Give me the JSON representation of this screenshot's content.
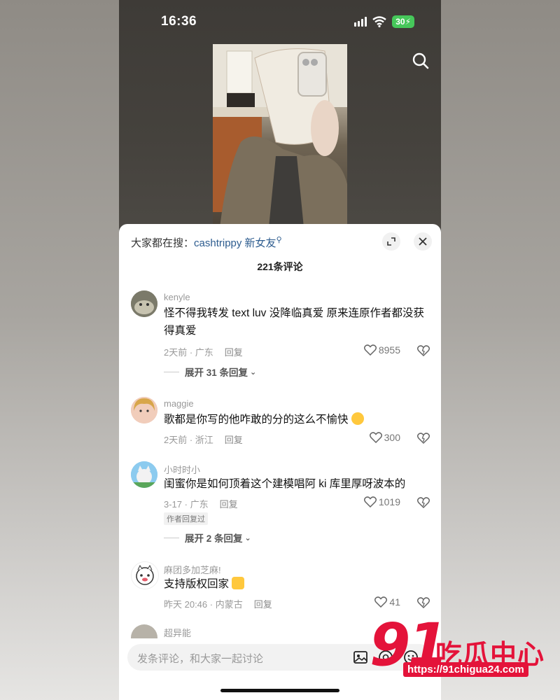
{
  "status": {
    "time": "16:36",
    "battery": "30"
  },
  "video": {
    "thumbnail": "mirror-selfie-photo"
  },
  "sheet": {
    "hot_search_prefix": "大家都在搜：",
    "hot_search_term": "cashtrippy 新女友",
    "comment_count": "221条评论"
  },
  "comments": [
    {
      "username": "kenyle",
      "text": "怪不得我转发 text luv 没降临真爱 原来连原作者都没获得真爱",
      "meta": "2天前 · 广东",
      "reply": "回复",
      "likes": "8955",
      "expand": "展开 31 条回复"
    },
    {
      "username": "maggie",
      "text": "歌都是你写的他咋敢的分的这么不愉快",
      "meta": "2天前 · 浙江",
      "reply": "回复",
      "likes": "300"
    },
    {
      "username": "小时时小",
      "text": "闺蜜你是如何顶着这个建模唱阿 ki 库里厚呀波本的",
      "meta": "3-17 · 广东",
      "reply": "回复",
      "likes": "1019",
      "author_tag": "作者回复过",
      "expand": "展开 2 条回复"
    },
    {
      "username": "麻团多加芝麻!",
      "text": "支持版权回家",
      "meta": "昨天 20:46 · 内蒙古",
      "reply": "回复",
      "likes": "41"
    },
    {
      "username": "超异能"
    }
  ],
  "input": {
    "placeholder": "发条评论，和大家一起讨论"
  },
  "watermark": {
    "number": "91",
    "title": "吃瓜中心",
    "url": "https://91chigua24.com"
  },
  "colors": {
    "accent_link": "#2d5c8f",
    "watermark_red": "#e4133a",
    "battery_green": "#46c75a"
  }
}
